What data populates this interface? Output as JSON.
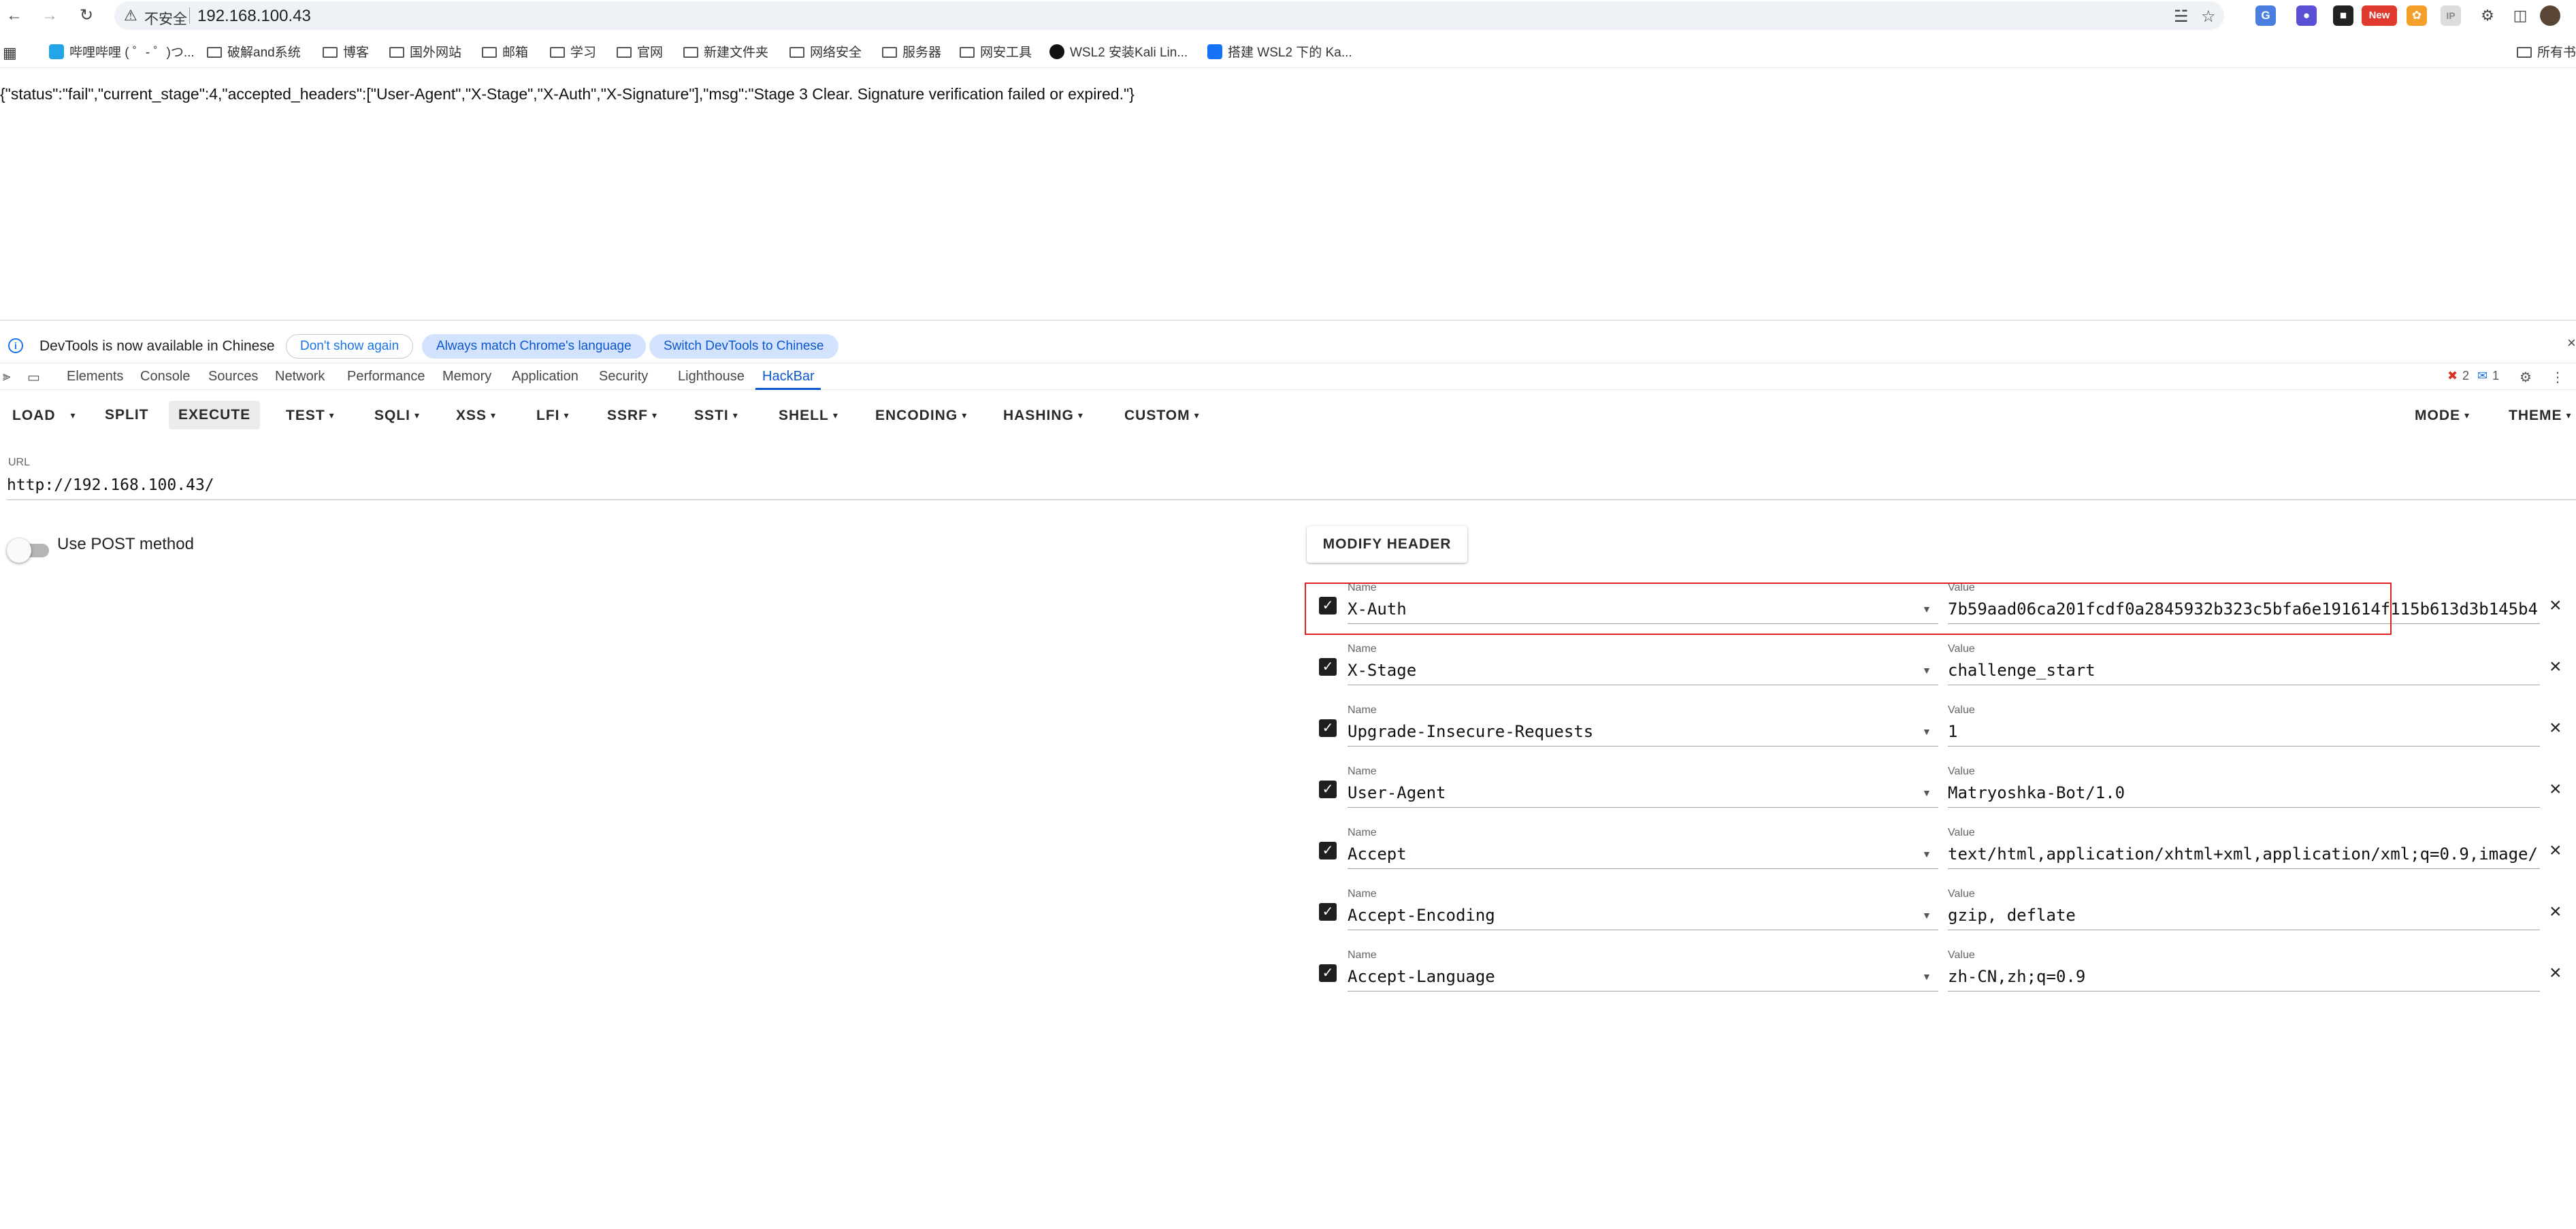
{
  "browser": {
    "security_label": "不安全",
    "address": "192.168.100.43",
    "bookmarks": [
      "哔哩哔哩 ( ゜- ゜)つ...",
      "破解and系统",
      "博客",
      "国外网站",
      "邮箱",
      "学习",
      "官网",
      "新建文件夹",
      "网络安全",
      "服务器",
      "网安工具",
      "WSL2 安装Kali Lin...",
      "搭建 WSL2 下的 Ka...",
      "所有书"
    ],
    "extension_badge": "New"
  },
  "page": {
    "response": "{\"status\":\"fail\",\"current_stage\":4,\"accepted_headers\":[\"User-Agent\",\"X-Stage\",\"X-Auth\",\"X-Signature\"],\"msg\":\"Stage 3 Clear. Signature verification failed or expired.\"}"
  },
  "devtools": {
    "infobar": {
      "text": "DevTools is now available in Chinese",
      "dont_show": "Don't show again",
      "match_language": "Always match Chrome's language",
      "switch_chinese": "Switch DevTools to Chinese"
    },
    "tabs": [
      "Elements",
      "Console",
      "Sources",
      "Network",
      "Performance",
      "Memory",
      "Application",
      "Security",
      "Lighthouse",
      "HackBar"
    ],
    "active_tab": "HackBar",
    "error_count": "2",
    "message_count": "1"
  },
  "hackbar": {
    "toolbar": [
      "LOAD",
      "SPLIT",
      "EXECUTE",
      "TEST",
      "SQLI",
      "XSS",
      "LFI",
      "SSRF",
      "SSTI",
      "SHELL",
      "ENCODING",
      "HASHING",
      "CUSTOM"
    ],
    "mode": "MODE",
    "theme": "THEME",
    "url_label": "URL",
    "url": "http://192.168.100.43/",
    "post_label": "Use POST method",
    "post_enabled": false,
    "modify_header": "MODIFY HEADER",
    "name_label": "Name",
    "value_label": "Value",
    "headers": [
      {
        "name": "X-Auth",
        "value": "7b59aad06ca201fcdf0a2845932b323c5bfa6e191614f115b613d3b145b4",
        "checked": true
      },
      {
        "name": "X-Stage",
        "value": "challenge_start",
        "checked": true
      },
      {
        "name": "Upgrade-Insecure-Requests",
        "value": "1",
        "checked": true
      },
      {
        "name": "User-Agent",
        "value": "Matryoshka-Bot/1.0",
        "checked": true
      },
      {
        "name": "Accept",
        "value": "text/html,application/xhtml+xml,application/xml;q=0.9,image/",
        "checked": true
      },
      {
        "name": "Accept-Encoding",
        "value": "gzip, deflate",
        "checked": true
      },
      {
        "name": "Accept-Language",
        "value": "zh-CN,zh;q=0.9",
        "checked": true
      }
    ]
  },
  "colors": {
    "accent": "#0b57d0",
    "highlight": "#e02020"
  }
}
